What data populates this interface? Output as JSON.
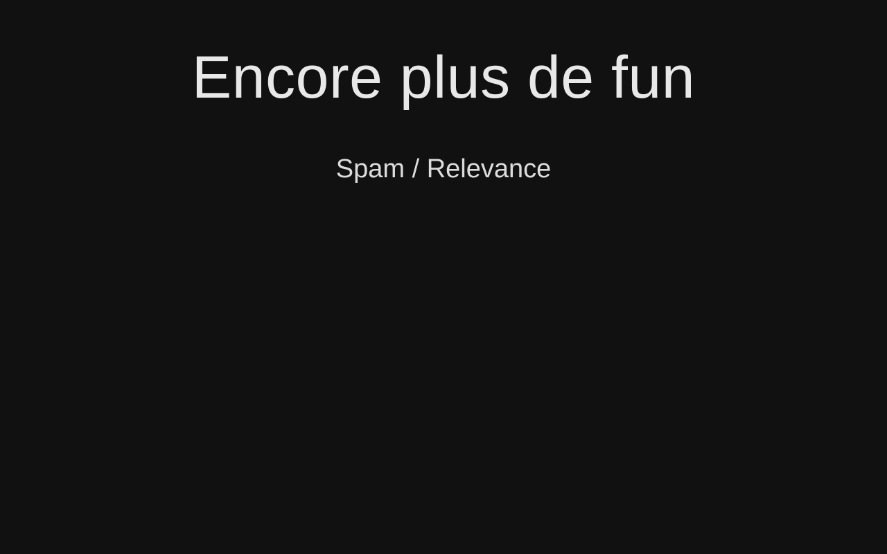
{
  "slide": {
    "title": "Encore plus de fun",
    "subtitle": "Spam / Relevance"
  },
  "colors": {
    "background": "#111111",
    "text": "#e6e6e6"
  }
}
